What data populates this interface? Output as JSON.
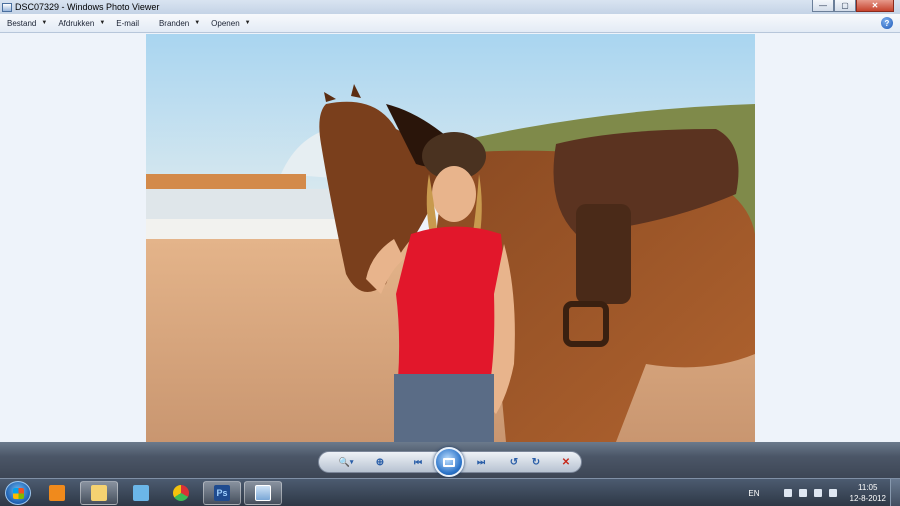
{
  "window": {
    "title": "DSC07329 - Windows Photo Viewer",
    "controls": {
      "minimize": "—",
      "maximize": "▢",
      "close": "✕"
    }
  },
  "menu": {
    "items": [
      {
        "label": "Bestand",
        "has_arrow": true
      },
      {
        "label": "Afdrukken",
        "has_arrow": true
      },
      {
        "label": "E-mail",
        "has_arrow": false
      },
      {
        "label": "Branden",
        "has_arrow": true
      },
      {
        "label": "Openen",
        "has_arrow": true
      }
    ],
    "arrow": "▼",
    "help": "?"
  },
  "viewer": {
    "photo_subject": "girl-with-horse-on-beach"
  },
  "controls": {
    "zoom": "🔍",
    "zoom_arrow": "▾",
    "fit": "⊕",
    "previous": "⏮",
    "next": "⏭",
    "rotate_ccw": "↺",
    "rotate_cw": "↻",
    "delete": "✕"
  },
  "taskbar": {
    "apps": [
      {
        "name": "media-player",
        "open": false,
        "color": "#f08a1c"
      },
      {
        "name": "explorer",
        "open": true,
        "color": "#f5d271"
      },
      {
        "name": "network",
        "open": false,
        "color": "#6bb6e8"
      },
      {
        "name": "chrome",
        "open": false,
        "color": "#3f9b3f"
      },
      {
        "name": "photoshop",
        "open": true,
        "color": "#1f4b8f"
      },
      {
        "name": "photo-viewer",
        "open": true,
        "color": "#7aa7d6"
      }
    ],
    "photoshop_label": "Ps",
    "language": "EN",
    "time": "11:05",
    "date": "12-8-2012"
  },
  "colors": {
    "accent": "#2a73c9",
    "viewer_bg": "#eef3fa",
    "close_red": "#c6432d"
  }
}
